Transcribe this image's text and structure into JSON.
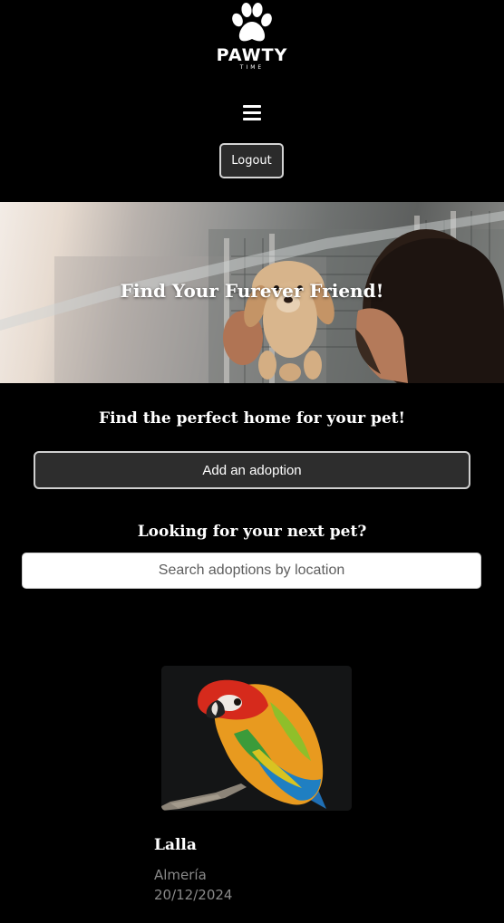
{
  "header": {
    "logo_text": "PAWTY",
    "logo_subtext": "TIME",
    "logo_icon": "paw-icon",
    "menu_icon": "hamburger-menu-icon",
    "logout_label": "Logout"
  },
  "hero": {
    "title": "Find Your Furever Friend!"
  },
  "main": {
    "tagline": "Find the perfect home for your pet!",
    "add_button_label": "Add an adoption",
    "search_heading": "Looking for your next pet?",
    "search_placeholder": "Search adoptions by location"
  },
  "adoptions": [
    {
      "name": "Lalla",
      "location": "Almería",
      "date": "20/12/2024"
    }
  ]
}
